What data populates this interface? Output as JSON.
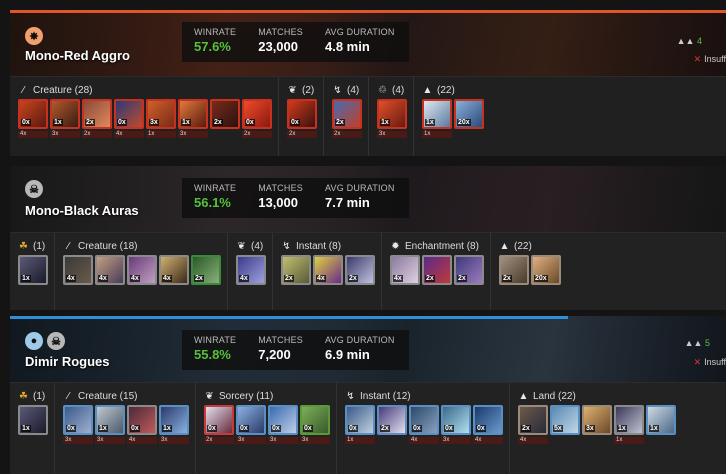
{
  "decks": [
    {
      "name": "Mono-Red Aggro",
      "mana_icon": "fire-icon",
      "accent": "#e0552a",
      "stats": [
        {
          "label": "WINRATE",
          "value": "57.6%"
        },
        {
          "label": "MATCHES",
          "value": "23,000"
        },
        {
          "label": "AVG DURATION",
          "value": "4.8 min"
        }
      ],
      "right_up": "4",
      "right_note": "Insuff",
      "groups": [
        {
          "icon": "creature-icon",
          "label": "Creature (28)",
          "tiles": [
            {
              "count": "0x",
              "sub": "4x"
            },
            {
              "count": "1x",
              "sub": "3x"
            },
            {
              "count": "2x",
              "sub": "2x"
            },
            {
              "count": "0x",
              "sub": "4x"
            },
            {
              "count": "3x",
              "sub": "1x"
            },
            {
              "count": "1x",
              "sub": "3x"
            },
            {
              "count": "2x",
              "sub": ""
            },
            {
              "count": "0x",
              "sub": "2x"
            }
          ]
        },
        {
          "icon": "sorcery-icon",
          "label": "(2)",
          "tiles": [
            {
              "count": "0x",
              "sub": "2x"
            }
          ]
        },
        {
          "icon": "instant-icon",
          "label": "(4)",
          "tiles": [
            {
              "count": "2x",
              "sub": "2x"
            }
          ]
        },
        {
          "icon": "artifact-icon",
          "label": "(4)",
          "tiles": [
            {
              "count": "1x",
              "sub": "3x"
            }
          ]
        },
        {
          "icon": "land-icon",
          "label": "(22)",
          "tiles": [
            {
              "count": "1x",
              "sub": "1x"
            },
            {
              "count": "20x",
              "sub": ""
            }
          ]
        }
      ]
    },
    {
      "name": "Mono-Black Auras",
      "mana_icon": "skull-icon",
      "accent": "#aaaaaa",
      "stats": [
        {
          "label": "WINRATE",
          "value": "56.1%"
        },
        {
          "label": "MATCHES",
          "value": "13,000"
        },
        {
          "label": "AVG DURATION",
          "value": "7.7 min"
        }
      ],
      "right_up": "",
      "right_note": "",
      "groups": [
        {
          "icon": "companion-icon",
          "label": "(1)",
          "tiles": [
            {
              "count": "1x",
              "sub": ""
            }
          ]
        },
        {
          "icon": "creature-icon",
          "label": "Creature (18)",
          "tiles": [
            {
              "count": "4x",
              "sub": ""
            },
            {
              "count": "4x",
              "sub": ""
            },
            {
              "count": "4x",
              "sub": ""
            },
            {
              "count": "4x",
              "sub": ""
            },
            {
              "count": "2x",
              "sub": ""
            }
          ]
        },
        {
          "icon": "sorcery-icon",
          "label": "(4)",
          "tiles": [
            {
              "count": "4x",
              "sub": ""
            }
          ]
        },
        {
          "icon": "instant-icon",
          "label": "Instant (8)",
          "tiles": [
            {
              "count": "2x",
              "sub": ""
            },
            {
              "count": "4x",
              "sub": ""
            },
            {
              "count": "2x",
              "sub": ""
            }
          ]
        },
        {
          "icon": "enchantment-icon",
          "label": "Enchantment (8)",
          "tiles": [
            {
              "count": "4x",
              "sub": ""
            },
            {
              "count": "2x",
              "sub": ""
            },
            {
              "count": "2x",
              "sub": ""
            }
          ]
        },
        {
          "icon": "land-icon",
          "label": "(22)",
          "tiles": [
            {
              "count": "2x",
              "sub": ""
            },
            {
              "count": "20x",
              "sub": ""
            }
          ]
        }
      ]
    },
    {
      "name": "Dimir Rogues",
      "mana_icon": "water-skull-icon",
      "accent": "#2f8fd8",
      "stats": [
        {
          "label": "WINRATE",
          "value": "55.8%"
        },
        {
          "label": "MATCHES",
          "value": "7,200"
        },
        {
          "label": "AVG DURATION",
          "value": "6.9 min"
        }
      ],
      "right_up": "5",
      "right_note": "Insuff",
      "groups": [
        {
          "icon": "companion-icon",
          "label": "(1)",
          "tiles": [
            {
              "count": "1x",
              "sub": ""
            }
          ]
        },
        {
          "icon": "creature-icon",
          "label": "Creature (15)",
          "tiles": [
            {
              "count": "0x",
              "sub": "3x"
            },
            {
              "count": "1x",
              "sub": "3x"
            },
            {
              "count": "0x",
              "sub": "4x"
            },
            {
              "count": "1x",
              "sub": "3x"
            }
          ]
        },
        {
          "icon": "sorcery-icon",
          "label": "Sorcery (11)",
          "tiles": [
            {
              "count": "0x",
              "sub": "2x"
            },
            {
              "count": "0x",
              "sub": "3x"
            },
            {
              "count": "0x",
              "sub": "3x"
            },
            {
              "count": "0x",
              "sub": "3x"
            }
          ]
        },
        {
          "icon": "instant-icon",
          "label": "Instant (12)",
          "tiles": [
            {
              "count": "0x",
              "sub": "1x"
            },
            {
              "count": "2x",
              "sub": ""
            },
            {
              "count": "0x",
              "sub": "4x"
            },
            {
              "count": "0x",
              "sub": "3x"
            },
            {
              "count": "0x",
              "sub": "4x"
            }
          ]
        },
        {
          "icon": "land-icon",
          "label": "Land (22)",
          "tiles": [
            {
              "count": "2x",
              "sub": "4x"
            },
            {
              "count": "5x",
              "sub": ""
            },
            {
              "count": "3x",
              "sub": ""
            },
            {
              "count": "1x",
              "sub": "1x"
            },
            {
              "count": "1x",
              "sub": ""
            }
          ]
        }
      ]
    }
  ]
}
